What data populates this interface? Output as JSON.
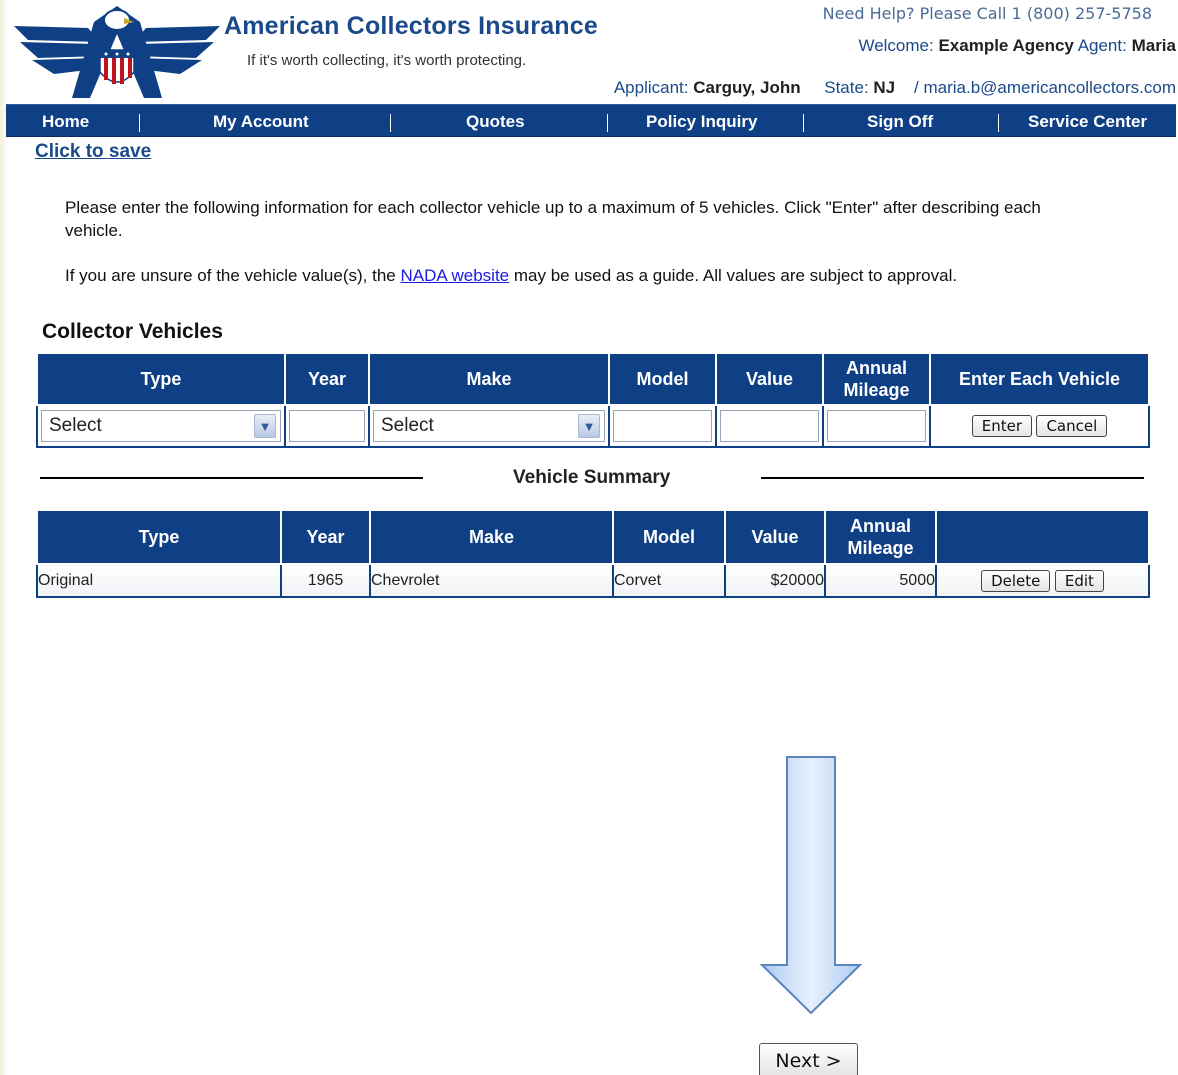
{
  "header": {
    "brand_title": "American Collectors Insurance",
    "tagline": "If it's worth collecting, it's worth protecting.",
    "help_text": "Need Help? Please Call 1 (800) 257-5758",
    "welcome_label": "Welcome:",
    "agency_name": "Example Agency",
    "agent_label": "Agent:",
    "agent_name": "Maria",
    "applicant_label": "Applicant:",
    "applicant_name": "Carguy, John",
    "state_label": "State:",
    "state_value": "NJ",
    "email": "/ maria.b@americancollectors.com"
  },
  "nav": {
    "items": [
      "Home",
      "My Account",
      "Quotes",
      "Policy Inquiry",
      "Sign Off",
      "Service Center"
    ]
  },
  "save_link": "Click to save",
  "intro": {
    "line1": "Please enter the following information for each collector vehicle up to a maximum of 5 vehicles. Click \"Enter\" after describing each vehicle.",
    "line2_before": "If you are unsure of the vehicle value(s), the ",
    "line2_link": "NADA website",
    "line2_after": " may be used as a guide. All values are subject to approval."
  },
  "section_title": "Collector Vehicles",
  "entry": {
    "headers": {
      "type": "Type",
      "year": "Year",
      "make": "Make",
      "model": "Model",
      "value": "Value",
      "mileage": "Annual Mileage",
      "action": "Enter Each Vehicle"
    },
    "type_selected": "Select",
    "make_selected": "Select",
    "year_value": "",
    "model_value": "",
    "value_value": "",
    "mileage_value": "",
    "enter_label": "Enter",
    "cancel_label": "Cancel"
  },
  "summary": {
    "title": "Vehicle Summary",
    "headers": {
      "type": "Type",
      "year": "Year",
      "make": "Make",
      "model": "Model",
      "value": "Value",
      "mileage": "Annual Mileage",
      "action": ""
    },
    "rows": [
      {
        "type": "Original",
        "year": "1965",
        "make": "Chevrolet",
        "model": "Corvet",
        "value": "$20000",
        "mileage": "5000",
        "delete_label": "Delete",
        "edit_label": "Edit"
      }
    ]
  },
  "next_label": "Next >",
  "icons": {
    "logo": "eagle-shield-logo",
    "dropdown": "chevron-down-icon",
    "arrow": "down-arrow-icon"
  },
  "colors": {
    "nav_bg": "#0f3f85",
    "brand_blue": "#1a4a8a",
    "link_blue": "#1a1ae0"
  }
}
